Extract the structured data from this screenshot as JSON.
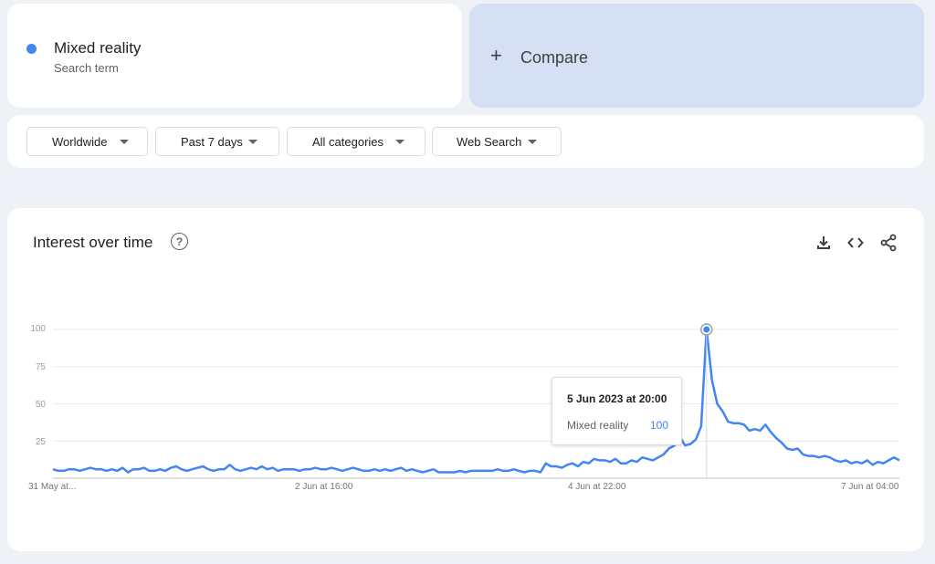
{
  "search_term": {
    "name": "Mixed reality",
    "type": "Search term",
    "color": "#4285f4"
  },
  "compare": {
    "icon": "plus-icon",
    "label": "Compare"
  },
  "filters": [
    {
      "label": "Worldwide"
    },
    {
      "label": "Past 7 days"
    },
    {
      "label": "All categories"
    },
    {
      "label": "Web Search"
    }
  ],
  "chart": {
    "title": "Interest over time",
    "icons": [
      "help-icon",
      "download-icon",
      "embed-icon",
      "share-icon"
    ],
    "tooltip": {
      "date": "5 Jun 2023 at 20:00",
      "series": "Mixed reality",
      "value": "100"
    }
  },
  "chart_data": {
    "type": "line",
    "series": [
      {
        "name": "Mixed reality",
        "color": "#4285f4",
        "values": [
          6,
          5,
          5,
          6,
          6,
          5,
          6,
          7,
          6,
          6,
          5,
          6,
          5,
          7,
          4,
          6,
          6,
          7,
          5,
          5,
          6,
          5,
          7,
          8,
          6,
          5,
          6,
          7,
          8,
          6,
          5,
          6,
          6,
          9,
          6,
          5,
          6,
          7,
          6,
          8,
          6,
          7,
          5,
          6,
          6,
          6,
          5,
          6,
          6,
          7,
          6,
          6,
          7,
          6,
          5,
          6,
          7,
          6,
          5,
          5,
          6,
          5,
          6,
          5,
          6,
          7,
          5,
          6,
          5,
          4,
          5,
          6,
          4,
          4,
          4,
          4,
          5,
          4,
          5,
          5,
          5,
          5,
          5,
          6,
          5,
          5,
          6,
          5,
          4,
          5,
          5,
          4,
          10,
          8,
          8,
          7,
          9,
          10,
          8,
          11,
          10,
          13,
          12,
          12,
          11,
          13,
          10,
          10,
          12,
          11,
          14,
          13,
          12,
          14,
          16,
          20,
          22,
          28,
          22,
          23,
          26,
          35,
          100,
          66,
          50,
          45,
          38,
          37,
          37,
          36,
          32,
          33,
          32,
          36,
          31,
          27,
          24,
          20,
          19,
          20,
          16,
          15,
          15,
          14,
          15,
          14,
          12,
          11,
          12,
          10,
          11,
          10,
          12,
          9,
          11,
          10,
          12,
          14,
          12
        ]
      }
    ],
    "x_tick_labels": [
      "31 May at...",
      "2 Jun at 16:00",
      "4 Jun at 22:00",
      "7 Jun at 04:00"
    ],
    "y_tick_labels": [
      "100",
      "75",
      "50",
      "25"
    ],
    "ylim": [
      0,
      100
    ],
    "grid": true,
    "legend": "none",
    "highlight": {
      "label": "5 Jun 2023 at 20:00",
      "value": 100
    }
  }
}
